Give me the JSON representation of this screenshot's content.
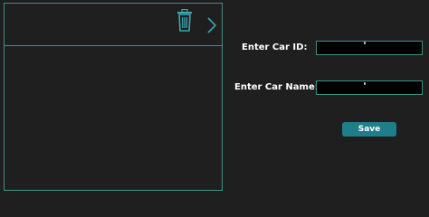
{
  "toolbar": {
    "delete_icon": "trash-icon",
    "next_icon": "chevron-right-icon"
  },
  "form": {
    "car_id_label": "Enter Car ID:",
    "car_id_value": "",
    "car_name_label": "Enter Car Name:",
    "car_name_value": "",
    "save_label": "Save"
  },
  "colors": {
    "background": "#1f1f1f",
    "accent_border": "#3f8f8b",
    "icon": "#3aa6b0",
    "button": "#1f7d8c",
    "input_background": "#000000"
  }
}
